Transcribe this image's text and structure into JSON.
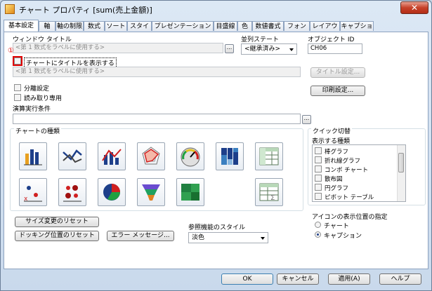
{
  "window": {
    "title": "チャート プロパティ [sum(売上金額)]",
    "close_glyph": "✕"
  },
  "tabs": [
    "基本設定",
    "軸",
    "軸の制限",
    "数式",
    "ソート",
    "スタイル",
    "プレゼンテーション",
    "目盛線",
    "色",
    "数値書式",
    "フォント",
    "レイアウト",
    "キャプション"
  ],
  "active_tab": "基本設定",
  "fields": {
    "window_title_label": "ウィンドウ タイトル",
    "window_title_placeholder": "<第 1 数式をラベルに使用する>",
    "sort_state_label": "並列ステート",
    "sort_state_value": "<継承済み>",
    "object_id_label": "オブジェクト ID",
    "object_id_value": "CH06",
    "marker": "①",
    "show_title_label": "チャートにタイトルを表示する",
    "chart_title_placeholder": "<第 1 数式をラベルに使用する>",
    "title_settings_button": "タイトル設定...",
    "detach_label": "分離設定",
    "readonly_label": "読み取り専用",
    "print_settings_button": "印刷設定...",
    "calc_condition_label": "演算実行条件",
    "ellipsis": "..."
  },
  "chart_types": {
    "label": "チャートの種類",
    "icons": [
      "bar-chart-icon",
      "line-chart-icon",
      "combo-chart-icon",
      "radar-chart-icon",
      "gauge-chart-icon",
      "mekko-chart-icon",
      "pivot-table-icon",
      "scatter-chart-icon",
      "grid-chart-icon",
      "pie-chart-icon",
      "funnel-chart-icon",
      "block-chart-icon",
      "straight-table-icon"
    ]
  },
  "quick_type": {
    "label": "クイック切替",
    "list_label": "表示する種類",
    "items": [
      "棒グラフ",
      "折れ線グラフ",
      "コンボ チャート",
      "散布図",
      "円グラフ",
      "ピボット テーブル"
    ]
  },
  "icon_position": {
    "label": "アイコンの表示位置の指定",
    "options": [
      "チャート",
      "キャプション"
    ],
    "selected": "キャプション"
  },
  "reset_buttons": {
    "size": "サイズ変更のリセット",
    "docking": "ドッキング位置のリセット",
    "error": "エラー メッセージ..."
  },
  "reference_style": {
    "label": "参照機能のスタイル",
    "value": "淡色"
  },
  "dialog_buttons": {
    "ok": "OK",
    "cancel": "キャンセル",
    "apply": "適用(A)",
    "help": "ヘルプ"
  },
  "colors": {
    "accent": "#1d3f8a",
    "highlight": "#e00000",
    "window": "#c9d9ec"
  }
}
